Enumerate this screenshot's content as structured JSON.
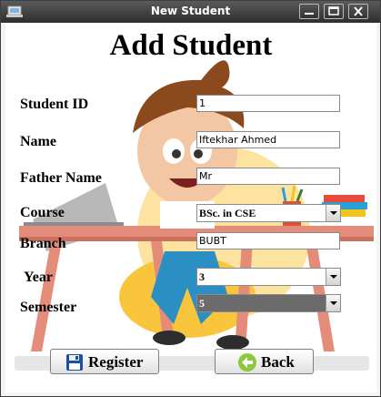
{
  "window": {
    "title": "New Student"
  },
  "heading": "Add Student",
  "form": {
    "student_id": {
      "label": "Student ID",
      "value": "1"
    },
    "name": {
      "label": "Name",
      "value": "Iftekhar Ahmed"
    },
    "father_name": {
      "label": "Father Name",
      "value": "Mr"
    },
    "course": {
      "label": "Course",
      "value": "BSc. in CSE"
    },
    "branch": {
      "label": "Branch",
      "value": "BUBT"
    },
    "year": {
      "label": "Year",
      "value": "3"
    },
    "semester": {
      "label": "Semester",
      "value": "5"
    }
  },
  "buttons": {
    "register": "Register",
    "back": "Back"
  },
  "icons": {
    "app": "app-icon",
    "register": "floppy-disk-icon",
    "back": "back-arrow-icon"
  },
  "colors": {
    "titlebar": "#2e2e2e",
    "title_text": "#ffffff",
    "back_icon": "#8dc63f",
    "floppy": "#1e4fa3"
  }
}
